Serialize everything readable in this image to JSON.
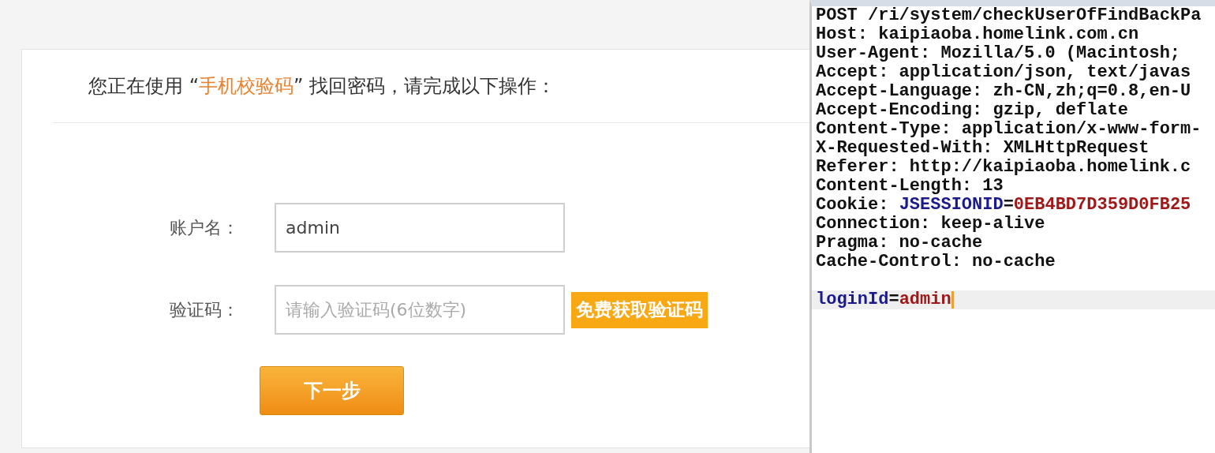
{
  "heading": {
    "before": "您正在使用 “",
    "highlight": "手机校验码",
    "after": "” 找回密码，请完成以下操作："
  },
  "form": {
    "fields": [
      {
        "label": "账户名：",
        "value": "admin"
      },
      {
        "label": "验证码：",
        "placeholder": "请输入验证码(6位数字)"
      }
    ],
    "code_button": "免费获取验证码",
    "next_button": "下一步"
  },
  "request": {
    "lines": [
      {
        "kind": "header",
        "parts": [
          {
            "kind": "plain",
            "text": "POST /ri/system/checkUserOfFindBackPa"
          }
        ]
      },
      {
        "kind": "header",
        "parts": [
          {
            "kind": "plain",
            "text": "Host: kaipiaoba.homelink.com.cn"
          }
        ]
      },
      {
        "kind": "header",
        "parts": [
          {
            "kind": "plain",
            "text": "User-Agent: Mozilla/5.0 (Macintosh;"
          }
        ]
      },
      {
        "kind": "header",
        "parts": [
          {
            "kind": "plain",
            "text": "Accept: application/json, text/javas"
          }
        ]
      },
      {
        "kind": "header",
        "parts": [
          {
            "kind": "plain",
            "text": "Accept-Language: zh-CN,zh;q=0.8,en-U"
          }
        ]
      },
      {
        "kind": "header",
        "parts": [
          {
            "kind": "plain",
            "text": "Accept-Encoding: gzip, deflate"
          }
        ]
      },
      {
        "kind": "header",
        "parts": [
          {
            "kind": "plain",
            "text": "Content-Type: application/x-www-form-"
          }
        ]
      },
      {
        "kind": "header",
        "parts": [
          {
            "kind": "plain",
            "text": "X-Requested-With: XMLHttpRequest"
          }
        ]
      },
      {
        "kind": "header",
        "parts": [
          {
            "kind": "plain",
            "text": "Referer: http://kaipiaoba.homelink.c"
          }
        ]
      },
      {
        "kind": "header",
        "parts": [
          {
            "kind": "plain",
            "text": "Content-Length: 13"
          }
        ]
      },
      {
        "kind": "header",
        "parts": [
          {
            "kind": "plain",
            "text": "Cookie: "
          },
          {
            "kind": "key",
            "text": "JSESSIONID"
          },
          {
            "kind": "plain",
            "text": "="
          },
          {
            "kind": "value",
            "text": "0EB4BD7D359D0FB25"
          }
        ]
      },
      {
        "kind": "header",
        "parts": [
          {
            "kind": "plain",
            "text": "Connection: keep-alive"
          }
        ]
      },
      {
        "kind": "header",
        "parts": [
          {
            "kind": "plain",
            "text": "Pragma: no-cache"
          }
        ]
      },
      {
        "kind": "header",
        "parts": [
          {
            "kind": "plain",
            "text": "Cache-Control: no-cache"
          }
        ]
      },
      {
        "kind": "blank"
      },
      {
        "kind": "body",
        "parts": [
          {
            "kind": "key",
            "text": "loginId"
          },
          {
            "kind": "plain",
            "text": "="
          },
          {
            "kind": "value",
            "text": "admin"
          }
        ]
      }
    ]
  }
}
